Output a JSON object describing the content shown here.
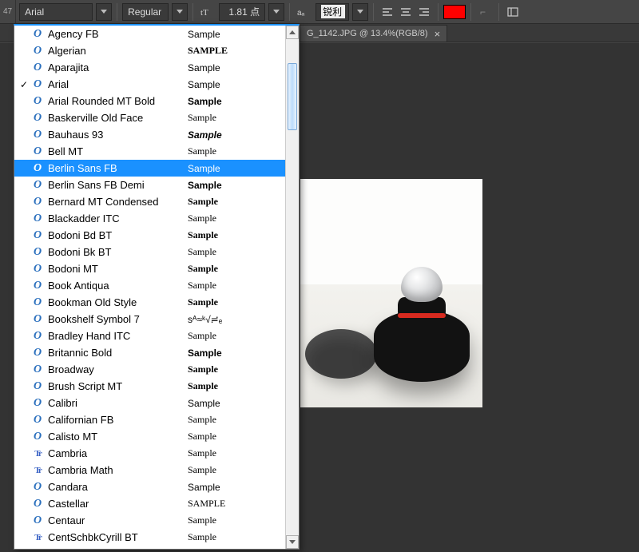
{
  "toolbar": {
    "edge_label": "47",
    "font_family": "Arial",
    "font_style": "Regular",
    "font_size_value": "1.81 点",
    "aa_mode": "锐利"
  },
  "tab": {
    "title": "G_1142.JPG @ 13.4%(RGB/8)"
  },
  "swatch_color": "#ff0000",
  "font_dropdown": {
    "checked": "Arial",
    "selected": "Berlin Sans FB",
    "items": [
      {
        "name": "Agency FB",
        "sample": "Sample",
        "glyph": "O"
      },
      {
        "name": "Algerian",
        "sample": "SAMPLE",
        "glyph": "O",
        "bold": true,
        "serif": true
      },
      {
        "name": "Aparajita",
        "sample": "Sample",
        "glyph": "O"
      },
      {
        "name": "Arial",
        "sample": "Sample",
        "glyph": "O"
      },
      {
        "name": "Arial Rounded MT Bold",
        "sample": "Sample",
        "glyph": "O",
        "bold": true
      },
      {
        "name": "Baskerville Old Face",
        "sample": "Sample",
        "glyph": "O",
        "serif": true
      },
      {
        "name": "Bauhaus 93",
        "sample": "Sample",
        "glyph": "O",
        "boldItalic": true
      },
      {
        "name": "Bell MT",
        "sample": "Sample",
        "glyph": "O",
        "serif": true
      },
      {
        "name": "Berlin Sans FB",
        "sample": "Sample",
        "glyph": "O"
      },
      {
        "name": "Berlin Sans FB Demi",
        "sample": "Sample",
        "glyph": "O",
        "bold": true
      },
      {
        "name": "Bernard MT Condensed",
        "sample": "Sample",
        "glyph": "O",
        "bold": true,
        "serif": true
      },
      {
        "name": "Blackadder ITC",
        "sample": "Sample",
        "glyph": "O",
        "script": true
      },
      {
        "name": "Bodoni Bd BT",
        "sample": "Sample",
        "glyph": "O",
        "bold": true,
        "serif": true
      },
      {
        "name": "Bodoni Bk BT",
        "sample": "Sample",
        "glyph": "O",
        "serif": true
      },
      {
        "name": "Bodoni MT",
        "sample": "Sample",
        "glyph": "O",
        "bold": true,
        "serif": true
      },
      {
        "name": "Book Antiqua",
        "sample": "Sample",
        "glyph": "O",
        "serif": true
      },
      {
        "name": "Bookman Old Style",
        "sample": "Sample",
        "glyph": "O",
        "bold": true,
        "serif": true
      },
      {
        "name": "Bookshelf Symbol 7",
        "sample": "sᴬ≈ᵏ√≓ₑ",
        "glyph": "O"
      },
      {
        "name": "Bradley Hand ITC",
        "sample": "Sample",
        "glyph": "O",
        "script": true
      },
      {
        "name": "Britannic Bold",
        "sample": "Sample",
        "glyph": "O",
        "bold": true
      },
      {
        "name": "Broadway",
        "sample": "Sample",
        "glyph": "O",
        "bold": true,
        "serif": true
      },
      {
        "name": "Brush Script MT",
        "sample": "Sample",
        "glyph": "O",
        "script": true,
        "bold": true
      },
      {
        "name": "Calibri",
        "sample": "Sample",
        "glyph": "O"
      },
      {
        "name": "Californian FB",
        "sample": "Sample",
        "glyph": "O",
        "serif": true
      },
      {
        "name": "Calisto MT",
        "sample": "Sample",
        "glyph": "O",
        "serif": true
      },
      {
        "name": "Cambria",
        "sample": "Sample",
        "glyph": "T",
        "serif": true
      },
      {
        "name": "Cambria Math",
        "sample": "Sample",
        "glyph": "T",
        "serif": true
      },
      {
        "name": "Candara",
        "sample": "Sample",
        "glyph": "O"
      },
      {
        "name": "Castellar",
        "sample": "SAMPLE",
        "glyph": "O",
        "serif": true
      },
      {
        "name": "Centaur",
        "sample": "Sample",
        "glyph": "O",
        "serif": true
      },
      {
        "name": "CentSchbkCyrill BT",
        "sample": "Sample",
        "glyph": "T",
        "serif": true
      }
    ]
  }
}
